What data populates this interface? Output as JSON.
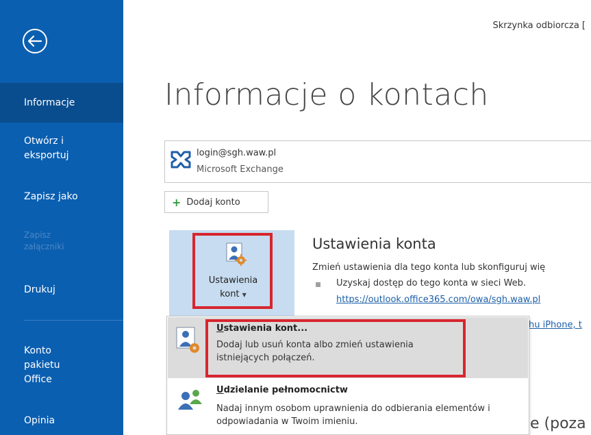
{
  "window": {
    "title": "Skrzynka odbiorcza ["
  },
  "sidebar": {
    "items": [
      {
        "label": "Informacje",
        "selected": true
      },
      {
        "label": "Otwórz i eksportuj"
      },
      {
        "label": "Zapisz jako"
      },
      {
        "label": "Zapisz załączniki",
        "disabled": true
      },
      {
        "label": "Drukuj"
      },
      {
        "label": "Konto pakietu Office"
      },
      {
        "label": "Opinia"
      }
    ]
  },
  "main": {
    "title": "Informacje o kontach",
    "account": {
      "email": "login@sgh.waw.pl",
      "type": "Microsoft Exchange"
    },
    "add_account": "Dodaj konto",
    "settings_tile": {
      "line1": "Ustawienia",
      "line2": "kont"
    },
    "section": {
      "heading": "Ustawienia konta",
      "description": "Zmień ustawienia dla tego konta lub skonfiguruj wię",
      "bullet": "Uzyskaj dostęp do tego konta w sieci Web.",
      "link": "https://outlook.office365.com/owa/sgh.waw.pl",
      "link2": "hu iPhone, t"
    },
    "partial_heading": "e (poza"
  },
  "dropdown": {
    "items": [
      {
        "title": "Ustawienia kont...",
        "description": "Dodaj lub usuń konta albo zmień ustawienia istniejących połączeń."
      },
      {
        "title": "Udzielanie pełnomocnictw",
        "description": "Nadaj innym osobom uprawnienia do odbierania elementów i odpowiadania w Twoim imieniu."
      }
    ]
  },
  "colors": {
    "sidebar": "#0b5fb0",
    "highlight": "#d7262e",
    "tile": "#c7dcf0",
    "link": "#1a5ea8"
  },
  "icons": [
    "back-arrow-icon",
    "exchange-icon",
    "plus-icon",
    "account-settings-icon",
    "delegate-access-icon",
    "chevron-down-icon"
  ]
}
